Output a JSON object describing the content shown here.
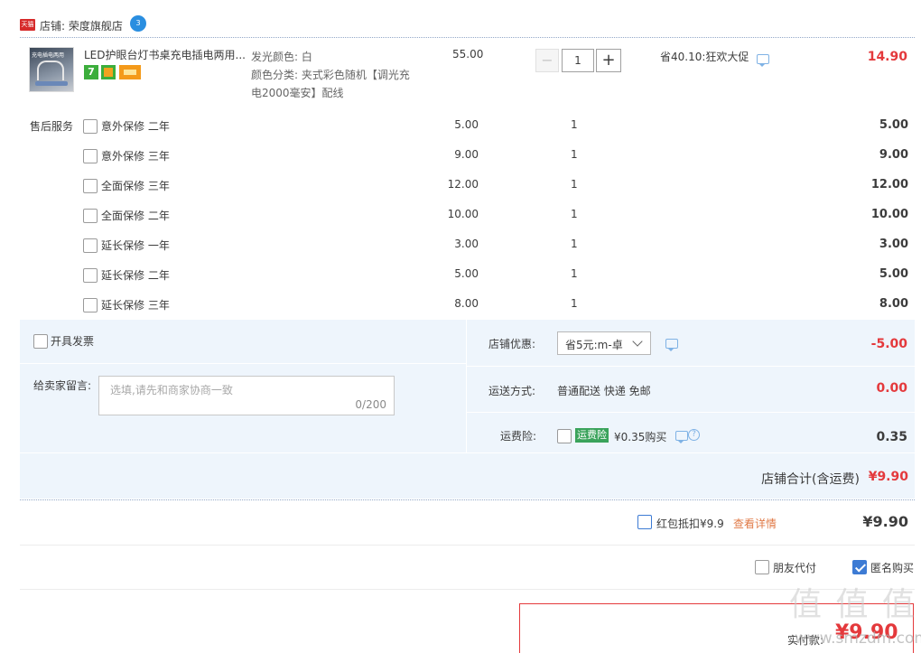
{
  "shop": {
    "badge": "天猫",
    "label": "店铺: 荣度旗舰店",
    "wangwang_badge": "3"
  },
  "item": {
    "title": "LED护眼台灯书桌充电插电两用...",
    "thumb_caption": "充电插电两用",
    "attr_color": "发光颜色: 白",
    "attr_category_line1": "颜色分类: 夹式彩色随机【调光充",
    "attr_category_line2": "电2000毫安】配线",
    "price": "55.00",
    "quantity": "1",
    "minus": "−",
    "plus": "+",
    "promo": "省40.10:狂欢大促",
    "subtotal": "14.90",
    "badge_colors": [
      "#3cae3c",
      "#f2a21f",
      "#f49a1a"
    ]
  },
  "services": {
    "label": "售后服务",
    "rows": [
      {
        "name": "意外保修 二年",
        "price": "5.00",
        "qty": "1",
        "total": "5.00"
      },
      {
        "name": "意外保修 三年",
        "price": "9.00",
        "qty": "1",
        "total": "9.00"
      },
      {
        "name": "全面保修 三年",
        "price": "12.00",
        "qty": "1",
        "total": "12.00"
      },
      {
        "name": "全面保修 二年",
        "price": "10.00",
        "qty": "1",
        "total": "10.00"
      },
      {
        "name": "延长保修 一年",
        "price": "3.00",
        "qty": "1",
        "total": "3.00"
      },
      {
        "name": "延长保修 二年",
        "price": "5.00",
        "qty": "1",
        "total": "5.00"
      },
      {
        "name": "延长保修 三年",
        "price": "8.00",
        "qty": "1",
        "total": "8.00"
      }
    ]
  },
  "order_box": {
    "invoice_label": "开具发票",
    "message_label": "给卖家留言:",
    "message_placeholder": "选填,请先和商家协商一致",
    "message_counter": "0/200",
    "discount_label": "店铺优惠:",
    "discount_select": "省5元:m-卓",
    "discount_amount": "-5.00",
    "shipping_label": "运送方式:",
    "shipping_value": "普通配送 快递 免邮",
    "shipping_amount": "0.00",
    "insurance_label": "运费险:",
    "insurance_tag": "运费险",
    "insurance_value": "¥0.35购买",
    "insurance_amount": "0.35",
    "shop_total_label": "店铺合计(含运费)",
    "shop_total_value": "¥9.90"
  },
  "redpacket": {
    "label": "红包抵扣¥9.9",
    "link": "查看详情",
    "total": "¥9.90"
  },
  "options": {
    "friend_pay": "朋友代付",
    "anonymous": "匿名购买"
  },
  "checkout": {
    "label": "实付款:",
    "amount": "¥9.90"
  },
  "watermark": {
    "text": "值 值 值",
    "domain": "www.smzdm.com"
  }
}
